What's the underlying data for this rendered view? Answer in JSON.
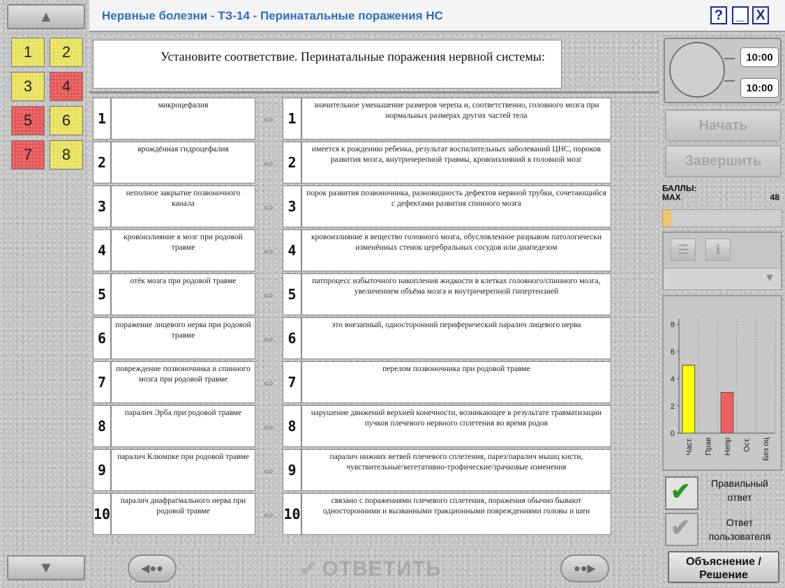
{
  "window": {
    "title": "Нервные болезни - ТЗ-14 - Перинатальные поражения НС",
    "help_label": "?",
    "minimize_label": "_",
    "close_label": "X"
  },
  "question_numbers": [
    {
      "label": "1",
      "status": "yellow"
    },
    {
      "label": "2",
      "status": "yellow"
    },
    {
      "label": "3",
      "status": "yellow"
    },
    {
      "label": "4",
      "status": "red"
    },
    {
      "label": "5",
      "status": "red"
    },
    {
      "label": "6",
      "status": "yellow"
    },
    {
      "label": "7",
      "status": "red"
    },
    {
      "label": "8",
      "status": "yellow"
    }
  ],
  "question": {
    "text": "Установите соответствие. Перинатальные поражения нервной системы:"
  },
  "pairs": [
    {
      "left_num": "1",
      "left": "микроцефалия",
      "right_num": "1",
      "right": "значительное уменьшение размеров черепа и, соответственно, головного мозга при нормальных размерах других частей тела"
    },
    {
      "left_num": "2",
      "left": "врождённая гидроцефалия",
      "right_num": "2",
      "right": "имеется к рождению ребенка, результат воспалительных заболеваний ЦНС, пороков развития мозга, внутричерепной травмы, кровоизлияний в головной мозг"
    },
    {
      "left_num": "3",
      "left": "неполное закрытие позвоночного канала",
      "right_num": "3",
      "right": "порок развития позвоночника, разновидность дефектов нервной трубки, сочетающийся с дефектами развития спинного мозга"
    },
    {
      "left_num": "4",
      "left": "кровоизлияние в мозг при родовой травме",
      "right_num": "4",
      "right": "кровоизлияние в вещество головного мозга, обусловленное разрывом патологически изменённых стенок церебральных сосудов или диапедезом"
    },
    {
      "left_num": "5",
      "left": "отёк мозга при родовой травме",
      "right_num": "5",
      "right": "патпроцесс избыточного накопления жидкости в клетках головного/спинного мозга, увеличением объёма мозга и внутричерепной гипертензией"
    },
    {
      "left_num": "6",
      "left": "поражение лицевого нерва при родовой травме",
      "right_num": "6",
      "right": "это внезапный, односторонний периферический паралич лицевого нерва"
    },
    {
      "left_num": "7",
      "left": "повреждение позвоночника и спинного мозга при родовой травме",
      "right_num": "7",
      "right": "перелом позвоночника при родовой травме"
    },
    {
      "left_num": "8",
      "left": "паралич Эрба при родовой травме",
      "right_num": "8",
      "right": "нарушение движений верхней конечности, возникающее в результате травматизации пучков плечевого нервного сплетения во время родов"
    },
    {
      "left_num": "9",
      "left": "паралич Клюмпке при родовой травме",
      "right_num": "9",
      "right": "паралич нижних ветвей плечевого сплетения, парез/паралич мышц кисти, чувствительные/вегетативно-трофические/зрачковые изменения"
    },
    {
      "left_num": "10",
      "left": "паралич диафрагмального нерва при родовой травме",
      "right_num": "10",
      "right": "связано с поражениями плечевого сплетения, поражения обычно бывают односторонними и вызванными тракционными повреждениями головы и шеи"
    }
  ],
  "timer": {
    "total": "10:00",
    "remaining": "10:00"
  },
  "controls": {
    "start_label": "Начать",
    "finish_label": "Завершить",
    "answer_label": "ОТВЕТИТЬ",
    "explanation_label": "Объяснение / Решение",
    "correct_answer_label": "Правильный ответ",
    "user_answer_label": "Ответ пользователя"
  },
  "score": {
    "label": "БАЛЛЫ:",
    "max_label": "MAX",
    "max_value": "48",
    "fraction": 0.07
  },
  "colors": {
    "yellow": "#e8e05a",
    "red": "#e55656",
    "accent": "#2a6fc4",
    "score_bar": "#f5c36a",
    "check_green": "#1f9a1f"
  },
  "chart_data": {
    "type": "bar",
    "categories": [
      "Част.",
      "Прав",
      "Непр",
      "Ост.",
      "Без оц"
    ],
    "values": [
      5,
      0,
      3,
      0,
      0
    ],
    "colors": [
      "#ffff00",
      "#ffff00",
      "#f06060",
      "#cccccc",
      "#cccccc"
    ],
    "ylim": [
      0,
      8
    ],
    "yticks": [
      0,
      2,
      4,
      6,
      8
    ],
    "grid": "vertical-dotted"
  }
}
